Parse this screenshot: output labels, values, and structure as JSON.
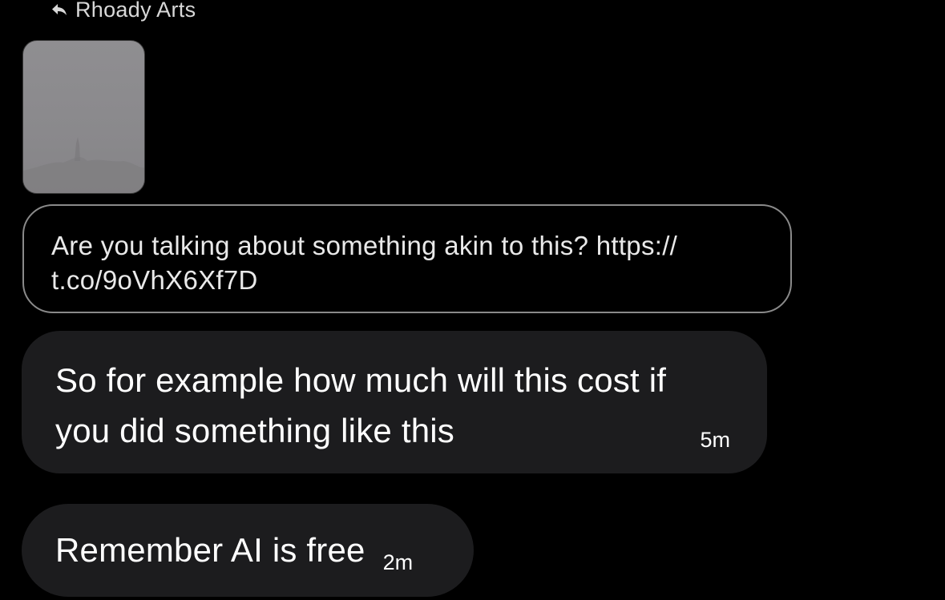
{
  "reply_header": {
    "icon": "reply-arrow-icon",
    "label": "Rhoady Arts"
  },
  "media": {
    "kind": "image-thumbnail"
  },
  "quoted_message": {
    "line1": "Are you talking about something akin to this? https://",
    "line2": "t.co/9oVhX6Xf7D"
  },
  "messages": [
    {
      "text_line1": "So for example how much will this cost if",
      "text_line2": "you did something like this",
      "time": "5m"
    },
    {
      "text": "Remember AI is free",
      "time": "2m"
    }
  ],
  "colors": {
    "background": "#000000",
    "bubble": "#1c1c1e",
    "outline": "#8a8a8a"
  }
}
